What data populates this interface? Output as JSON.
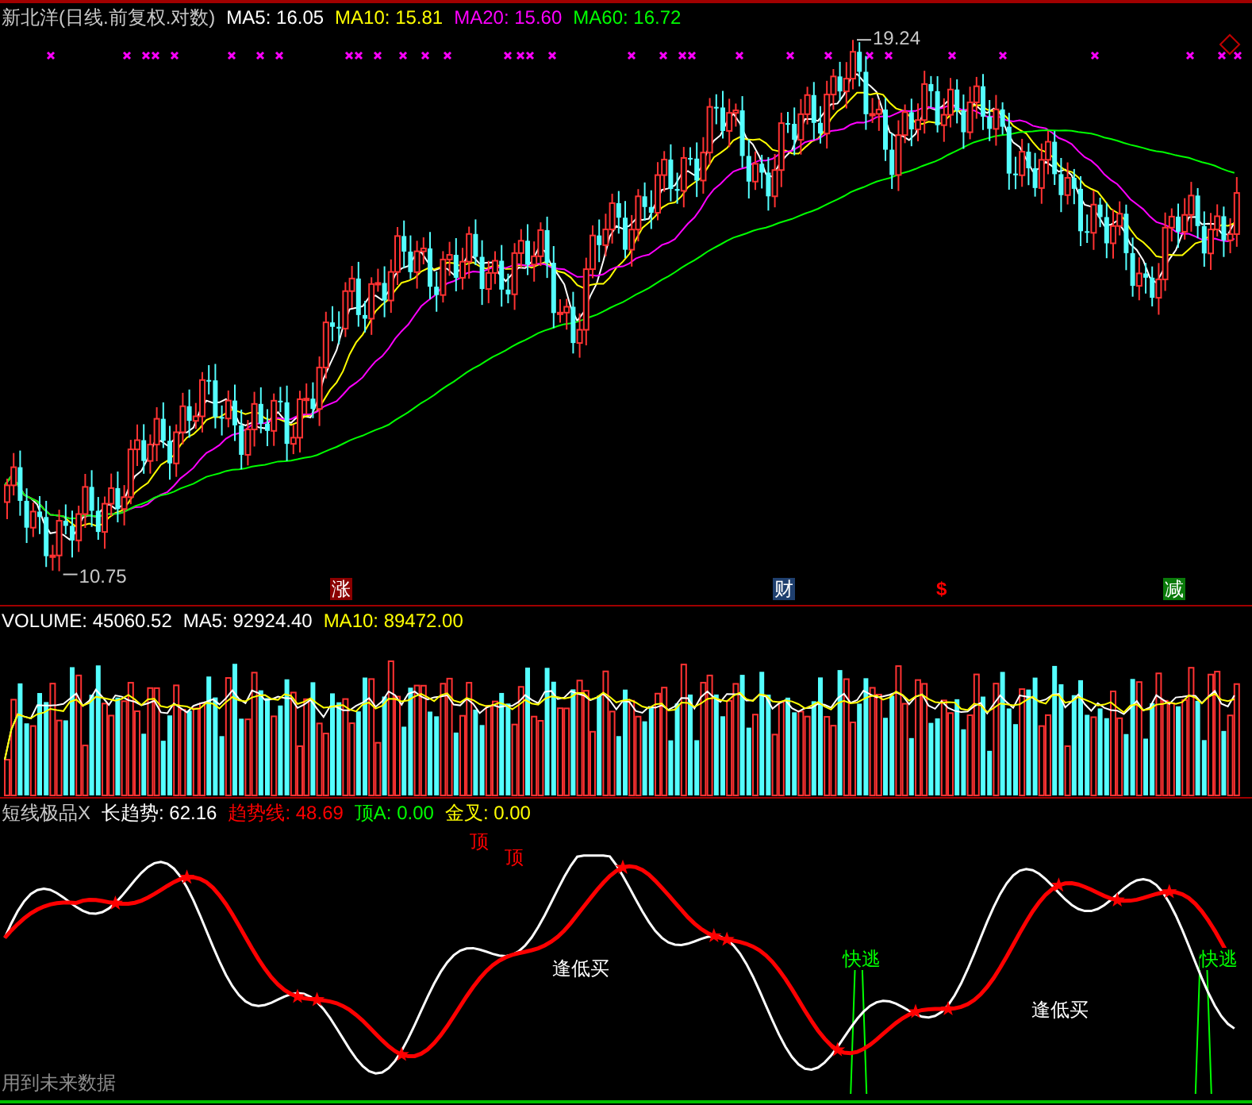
{
  "price_panel": {
    "title": "新北洋(日线.前复权.对数)",
    "indicators": [
      {
        "label": "MA5: 16.05",
        "color": "#ffffff"
      },
      {
        "label": "MA10: 15.81",
        "color": "#ffff00"
      },
      {
        "label": "MA20: 15.60",
        "color": "#ff00ff"
      },
      {
        "label": "MA60: 16.72",
        "color": "#00ff00"
      }
    ],
    "high_label": "19.24",
    "low_label": "10.75",
    "signals": [
      {
        "text": "涨",
        "kind": "badge",
        "color": "#8b0000"
      },
      {
        "text": "财",
        "kind": "badge",
        "color": "#1f3f6e"
      },
      {
        "text": "$",
        "kind": "symbol",
        "color": "#ff0000"
      },
      {
        "text": "减",
        "kind": "badge",
        "color": "#0a7a0a"
      }
    ]
  },
  "volume_panel": {
    "indicators": [
      {
        "label": "VOLUME: 45060.52",
        "color": "#ffffff"
      },
      {
        "label": "MA5: 92924.40",
        "color": "#ffffff"
      },
      {
        "label": "MA10: 89472.00",
        "color": "#ffff00"
      }
    ]
  },
  "indicator_panel": {
    "title": "短线极品X",
    "indicators": [
      {
        "label": "长趋势: 62.16",
        "color": "#ffffff"
      },
      {
        "label": "趋势线: 48.69",
        "color": "#ff0000"
      },
      {
        "label": "顶A: 0.00",
        "color": "#00ff00"
      },
      {
        "label": "金叉: 0.00",
        "color": "#ffff00"
      }
    ],
    "annotations": [
      {
        "text": "顶",
        "color": "#ff0000"
      },
      {
        "text": "顶",
        "color": "#ff0000"
      },
      {
        "text": "逢低买",
        "color": "#ffffff"
      },
      {
        "text": "快逃",
        "color": "#00ff00"
      },
      {
        "text": "逢低买",
        "color": "#ffffff"
      },
      {
        "text": "快逃",
        "color": "#00ff00"
      }
    ],
    "footnote": "用到未来数据"
  }
}
